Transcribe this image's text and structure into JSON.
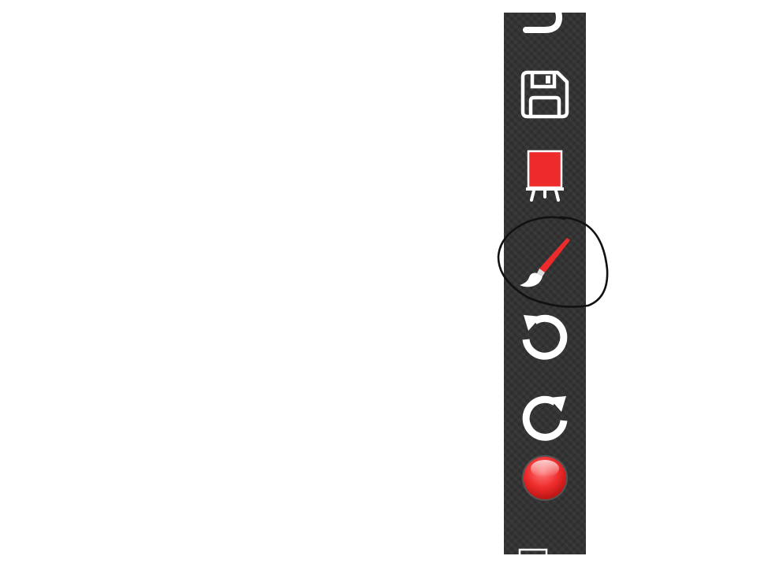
{
  "colors": {
    "toolbar_bg": "#333333",
    "canvas_bg": "#ffffff",
    "icon_white": "#ffffff",
    "accent_red": "#ee2b2b",
    "annotation_stroke": "#111111"
  },
  "toolbar": {
    "tools": [
      {
        "id": "share",
        "icon": "share-arrow-icon",
        "state": "partially-visible"
      },
      {
        "id": "save",
        "icon": "floppy-disk-icon"
      },
      {
        "id": "background-color",
        "icon": "easel-color-icon",
        "color": "#ee2b2b"
      },
      {
        "id": "brush",
        "icon": "paintbrush-icon",
        "color": "#ee2b2b",
        "annotated": true
      },
      {
        "id": "undo",
        "icon": "undo-icon"
      },
      {
        "id": "redo",
        "icon": "redo-icon"
      },
      {
        "id": "record",
        "icon": "record-button-icon",
        "color": "#ee2b2b"
      },
      {
        "id": "more",
        "icon": "square-outline-icon",
        "state": "partially-visible"
      }
    ]
  },
  "annotation": {
    "shape": "hand-drawn-circle",
    "target": "brush"
  }
}
